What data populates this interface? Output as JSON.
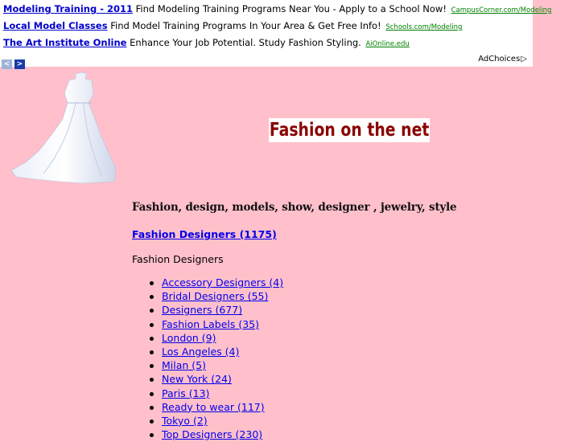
{
  "ads": [
    {
      "title": "Modeling Training - 2011",
      "text": "Find Modeling Training Programs Near You - Apply to a School Now!",
      "url": "CampusCorner.com/Modeling"
    },
    {
      "title": "Local Model Classes",
      "text": "Find Model Training Programs In Your Area & Get Free Info!",
      "url": "Schools.com/Modeling"
    },
    {
      "title": "The Art Institute Online",
      "text": "Enhance Your Job Potential. Study Fashion Styling.",
      "url": "AiOnline.edu"
    }
  ],
  "ad_nav": {
    "prev": "<",
    "next": ">"
  },
  "adchoices": "AdChoices",
  "site_title": "Fashion on the net",
  "tagline": "Fashion,  design, models, show, designer , jewelry, style",
  "category_link": "Fashion Designers (1175)",
  "section_label": "Fashion Designers",
  "subcategories": [
    "Accessory Designers (4)",
    "Bridal Designers (55)",
    "Designers (677)",
    "Fashion Labels (35)",
    "London (9)",
    "Los Angeles (4)",
    "Milan (5)",
    "New York (24)",
    "Paris (13)",
    "Ready to wear (117)",
    "Tokyo (2)",
    "Top Designers (230)"
  ]
}
